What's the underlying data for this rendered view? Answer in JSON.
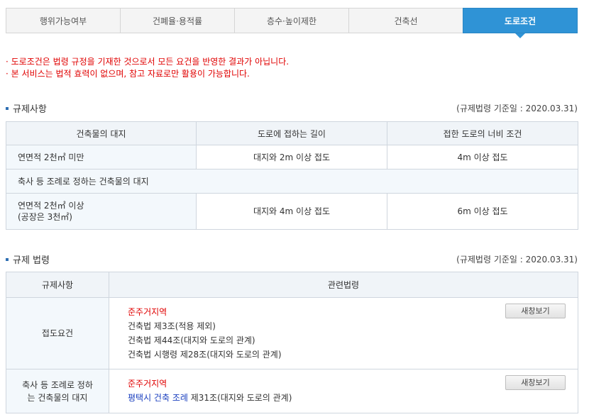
{
  "tabs": [
    {
      "label": "행위가능여부"
    },
    {
      "label": "건폐율·용적률"
    },
    {
      "label": "층수·높이제한"
    },
    {
      "label": "건축선"
    },
    {
      "label": "도로조건"
    }
  ],
  "notices": [
    "도로조건은 법령 규정을 기재한 것으로서 모든 요건을 반영한 결과가 아닙니다.",
    "본 서비스는 법적 효력이 없으며, 참고 자료로만 활용이 가능합니다."
  ],
  "regulation": {
    "title": "규제사항",
    "std_date": "(규제법령 기준일 : 2020.03.31)",
    "headers": [
      "건축물의 대지",
      "도로에 접하는 길이",
      "접한 도로의 너비 조건"
    ],
    "rows": [
      {
        "site": "연면적 2천㎡ 미만",
        "length": "대지와 2m 이상 접도",
        "width": "4m 이상 접도"
      },
      {
        "site": "축사 등 조례로 정하는 건축물의 대지"
      },
      {
        "site_line1": "연면적 2천㎡ 이상",
        "site_line2": "(공장은 3천㎡)",
        "length": "대지와 4m 이상 접도",
        "width": "6m 이상 접도"
      }
    ]
  },
  "laws": {
    "title": "규제 법령",
    "std_date": "(규제법령 기준일 : 2020.03.31)",
    "headers": [
      "규제사항",
      "관련법령"
    ],
    "rows": [
      {
        "item": "접도요건",
        "zone": "준주거지역",
        "lines": [
          "건축법 제3조(적용 제외)",
          "건축법 제44조(대지와 도로의 관계)",
          "건축법 시행령 제28조(대지와 도로의 관계)"
        ],
        "button": "새창보기"
      },
      {
        "item_line1": "축사 등 조례로 정하",
        "item_line2": "는 건축물의 대지",
        "zone": "준주거지역",
        "local_ordinance": "평택시 건축 조례",
        "local_article": " 제31조(대지와 도로의 관계)",
        "button": "새창보기"
      }
    ]
  }
}
